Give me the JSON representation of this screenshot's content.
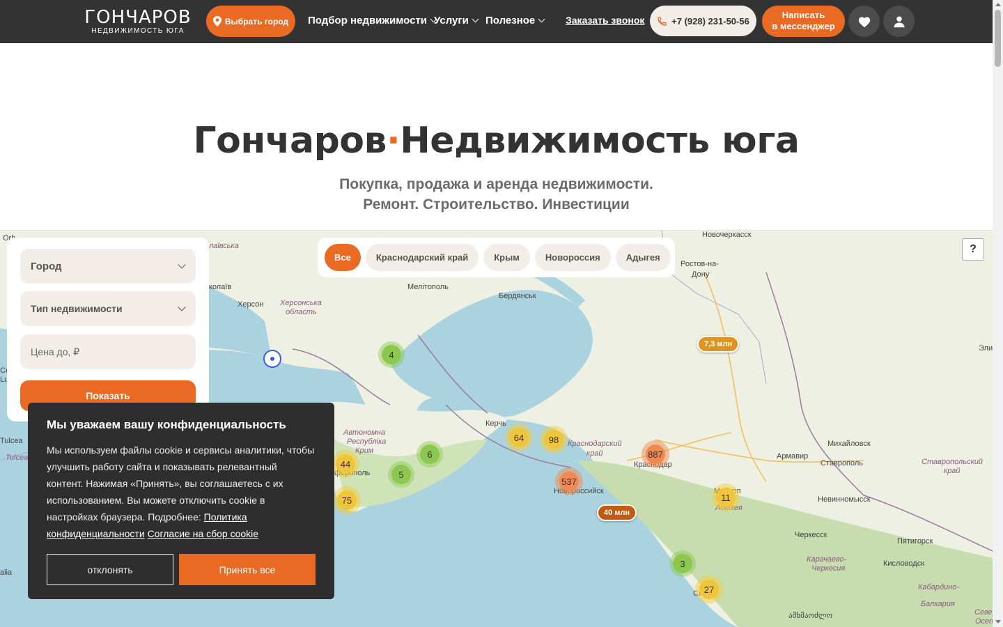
{
  "header": {
    "logo_main": "ГОНЧАРОВ",
    "logo_sub": "НЕДВИЖИМОСТЬ ЮГА",
    "city_button": "Выбрать город",
    "nav": [
      "Подбор недвижимости",
      "Услуги",
      "Полезное"
    ],
    "callback": "Заказать звонок",
    "phone": "+7 (928) 231-50-56",
    "messenger_line1": "Написать",
    "messenger_line2": "в мессенджер"
  },
  "hero": {
    "title_left": "Гончаров",
    "title_dot": "·",
    "title_right": "Недвижимость юга",
    "subtitle_line1": "Покупка, продажа и аренда недвижимости.",
    "subtitle_line2": "Ремонт. Строительство. Инвестиции"
  },
  "regions": [
    "Все",
    "Краснодарский край",
    "Крым",
    "Новороссия",
    "Адыгея"
  ],
  "active_region": "Все",
  "filter": {
    "city": "Город",
    "type": "Тип недвижимости",
    "price_placeholder": "Цена до, ₽",
    "submit": "Показать"
  },
  "map": {
    "help": "?",
    "labels": {
      "novocherkassk": "Новочеркасск",
      "rostov1": "Ростов-на-",
      "rostov2": "Дону",
      "melitopol": "Мелітополь",
      "berdyansk": "Бердянськ",
      "kherson": "Херсон",
      "kherson_obl1": "Херсонська",
      "kherson_obl2": "область",
      "mykolaiv_obl": "лаївська",
      "mykolaiv": "колаїв",
      "kerch": "Керчь",
      "krasnodar_krai1": "Краснодарский",
      "krasnodar_krai2": "край",
      "krasnodar": "Краснодар",
      "novorossiysk": "Новороссийск",
      "armavir": "Армавир",
      "mikhaylovsk": "Михайловск",
      "stavropol": "Ставрополь",
      "stavropol_krai1": "Ставропольский",
      "stavropol_krai2": "край",
      "nevinnomyssk": "Невинномысск",
      "cherkessk": "Черкесск",
      "pyatigorsk": "Пятигорск",
      "kislovodsk": "Кисловодск",
      "kchr1": "Карачаево-",
      "kchr2": "Черкесия",
      "kbr1": "Кабардино-",
      "kbr2": "Балкария",
      "crimea1": "Автономна",
      "crimea2": "Республіка",
      "crimea3": "Крим",
      "simferopol": "ферополь",
      "adygea": "Адыгея",
      "maykop": "Майкоп",
      "sochi": "Со",
      "georgia": "ამხმაოძლო",
      "tulcea": "Tulcea",
      "tulcea2": "Tulcea",
      "orh": "Orh",
      "elista": "Эли",
      "sever": "Север",
      "oset": "Осет",
      "alia": "alia",
      "ce": "Ce",
      "lu": "Lu"
    },
    "clusters": [
      {
        "label": "4",
        "color": "green"
      },
      {
        "label": "6",
        "color": "green"
      },
      {
        "label": "5",
        "color": "green"
      },
      {
        "label": "44",
        "color": "yellow"
      },
      {
        "label": "75",
        "color": "yellow"
      },
      {
        "label": "64",
        "color": "yellow"
      },
      {
        "label": "98",
        "color": "yellow"
      },
      {
        "label": "537",
        "color": "orange"
      },
      {
        "label": "887",
        "color": "orange"
      },
      {
        "label": "11",
        "color": "yellow"
      },
      {
        "label": "3",
        "color": "green"
      },
      {
        "label": "27",
        "color": "yellow"
      }
    ],
    "prices": [
      "7,3 млн",
      "40 млн"
    ]
  },
  "cookie": {
    "title": "Мы уважаем вашу конфиденциальность",
    "text": "Мы используем файлы cookie и сервисы аналитики, чтобы улучшить работу сайта и показывать релевантный контент. Нажимая «Принять», вы соглашаетесь с их использованием. Вы можете отключить cookie в настройках браузера. Подробнее:",
    "link1": "Политика конфиденциальности",
    "link2": "Согласие на сбор cookie",
    "decline": "отклонять",
    "accept": "Принять все"
  },
  "colors": {
    "brand": "#ea6a24",
    "header_bg": "#333333",
    "sea": "#aad3df"
  },
  "icons": [
    "location-pin-icon",
    "chevron-down-icon",
    "phone-icon",
    "heart-icon",
    "user-icon"
  ]
}
